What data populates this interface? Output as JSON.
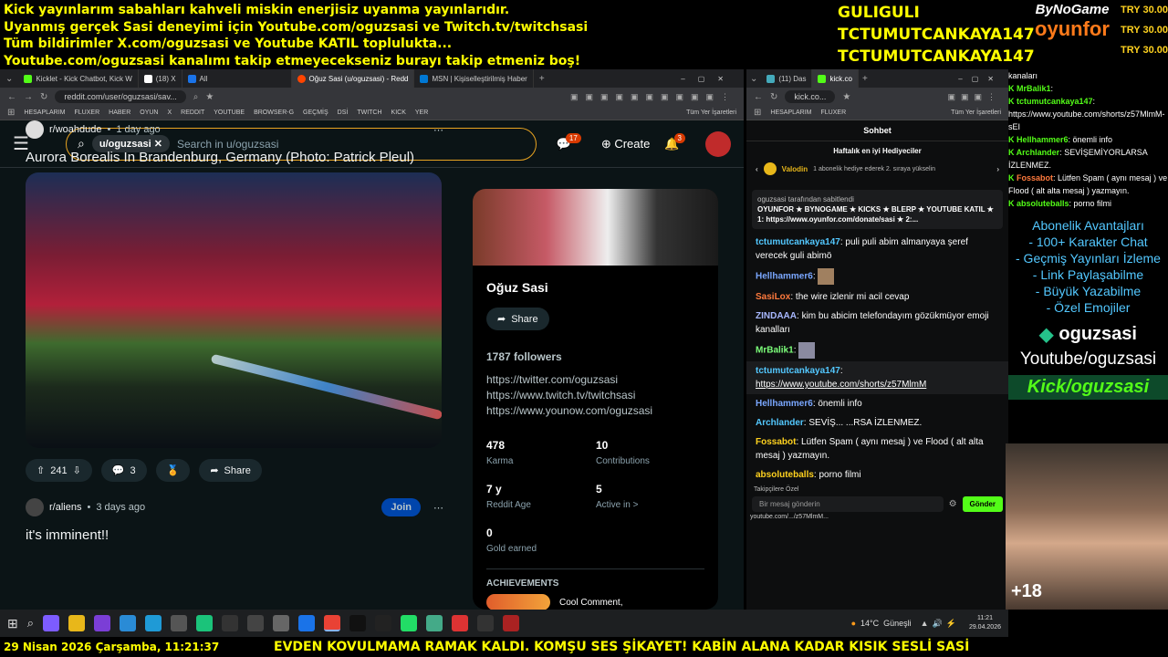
{
  "banner": {
    "lines": [
      "Kick yayınlarım sabahları kahveli miskin enerjisiz uyanma yayınlarıdır.",
      "Uyanmış gerçek Sasi deneyimi için Youtube.com/oguzsasi ve Twitch.tv/twitchsasi",
      "Tüm bildirimler X.com/oguzsasi ve Youtube KATIL toplulukta...",
      "Youtube.com/oguzsasi kanalımı takip etmeyecekseniz burayı takip etmeniz boş!"
    ]
  },
  "donors": [
    "GULIGULI",
    "TCTUMUTCANKAYA147",
    "TCTUMUTCANKAYA147"
  ],
  "bynogame": {
    "line1": "ByNoGame",
    "line2": "oyunfor"
  },
  "try": [
    "TRY 30.00",
    "TRY 30.00",
    "TRY 30.00"
  ],
  "browser1": {
    "tabs": [
      "Kicklet - Kick Chatbot, Kick W",
      "(18) X",
      "All",
      "Oğuz Sasi (u/oguzsasi) - Redd",
      "MSN | Kişiselleştirilmiş Haber"
    ],
    "url": "reddit.com/user/oguzsasi/sav...",
    "bookmarks": [
      "HESAPLARIM",
      "FLUXER",
      "HABER",
      "OYUN",
      "X",
      "REDDIT",
      "YOUTUBE",
      "BROWSER-G",
      "GEÇMİŞ",
      "DSİ",
      "TWITCH",
      "KICK",
      "YER",
      "Tüm Yer İşaretleri"
    ],
    "search_chip": "u/oguzsasi",
    "search_placeholder": "Search in u/oguzsasi",
    "chat_badge": "17",
    "notif_badge": "3",
    "create": "Create"
  },
  "feed": {
    "post1": {
      "sub": "r/woahdude",
      "time": "1 day ago",
      "title": "Aurora Borealis In Brandenburg, Germany (Photo: Patrick Pleul)",
      "votes": "241",
      "comments": "3",
      "share": "Share"
    },
    "post2": {
      "sub": "r/aliens",
      "time": "3 days ago",
      "title": "it's imminent!!",
      "join": "Join"
    }
  },
  "profile": {
    "name": "Oğuz Sasi",
    "share": "Share",
    "followers": "1787 followers",
    "links": [
      "https://twitter.com/oguzsasi",
      "https://www.twitch.tv/twitchsasi",
      "https://www.younow.com/oguzsasi"
    ],
    "stats": [
      {
        "v": "478",
        "l": "Karma"
      },
      {
        "v": "10",
        "l": "Contributions"
      },
      {
        "v": "7 y",
        "l": "Reddit Age"
      },
      {
        "v": "5",
        "l": "Active in >"
      },
      {
        "v": "0",
        "l": "Gold earned"
      }
    ],
    "achievements": "ACHIEVEMENTS",
    "achievement_name": "Cool Comment,"
  },
  "browser2": {
    "tabs": [
      "(11) Das",
      "kick.co"
    ],
    "url": "kick.co...",
    "bookmarks": [
      "HESAPLARIM",
      "FLUXER",
      "Tüm Yer İşaretleri"
    ],
    "chat_title": "Sohbet",
    "gifters_title": "Haftalık en iyi Hediyeciler",
    "gifter": "Valodin",
    "gifter_note": "1 abonelik hediye ederek 2. sıraya yükselin",
    "pinned_by": "oguzsasi tarafından sabitlendi",
    "pinned_text": "OYUNFOR ★ BYNOGAME ★ KICKS ★ BLERP ★ YOUTUBE KATIL ★ 1: https://www.oyunfor.com/donate/sasi ★ 2:...",
    "messages": [
      {
        "user": "tctumutcankaya147",
        "text": "puli puli abim almanyaya şeref verecek guli abimö"
      },
      {
        "user": "Hellhammer6",
        "text": ""
      },
      {
        "user": "SasiLox",
        "text": "the wire izlenir mi acil cevap"
      },
      {
        "user": "ZINDAAA",
        "text": "kim bu abicim telefondayım gözükmüyor emoji kanalları"
      },
      {
        "user": "MrBalik1",
        "text": ""
      },
      {
        "user": "tctumutcankaya147",
        "text": "https://www.youtube.com/shorts/z57MlmM"
      },
      {
        "user": "Hellhammer6",
        "text": "önemli info"
      },
      {
        "user": "Archlander",
        "text": "SEVİŞ... ...RSA İZLENMEZ."
      },
      {
        "user": "Fossabot",
        "text": "Lütfen Spam ( aynı mesaj ) ve Flood ( alt alta mesaj ) yazmayın."
      },
      {
        "user": "absoluteballs",
        "text": "porno filmi"
      }
    ],
    "followers_only": "Takipçilere Özel",
    "input_placeholder": "Bir mesaj gönderin",
    "send": "Gönder",
    "hover_url": "youtube.com/.../z57MlmM..."
  },
  "rightcol": {
    "messages": [
      {
        "user": "",
        "text": "kanaları"
      },
      {
        "user": "MrBalik1",
        "text": ":"
      },
      {
        "user": "tctumutcankaya147",
        "text": ": https://www.youtube.com/shorts/z57MlmM-sEI"
      },
      {
        "user": "Hellhammer6",
        "text": ": önemli info"
      },
      {
        "user": "Archlander",
        "text": ": SEVİŞEMİYORLARSA İZLENMEZ."
      },
      {
        "user": "Fossabot",
        "text": ": Lütfen Spam ( aynı mesaj ) ve Flood ( alt alta mesaj ) yazmayın."
      },
      {
        "user": "absoluteballs",
        "text": ": porno filmi"
      }
    ],
    "perks": [
      "Abonelik Avantajları",
      "- 100+ Karakter Chat",
      "- Geçmiş Yayınları İzleme",
      "- Link Paylaşabilme",
      "- Büyük Yazabilme",
      "- Özel Emojiler"
    ],
    "handle": "oguzsasi",
    "youtube": "Youtube/oguzsasi",
    "kick": "Kick/oguzsasi"
  },
  "cam": {
    "overlay": "+18"
  },
  "taskbar": {
    "weather": "14°C",
    "weather_text": "Güneşli",
    "time": "11:21",
    "date": "29.04.2026"
  },
  "ticker": {
    "date": "29 Nisan 2026 Çarşamba, 11:21:37",
    "text": "EVDEN KOVULMAMA RAMAK KALDI. KOMŞU SES ŞİKAYET! KABİN ALANA KADAR KISIK SESLİ SASİ"
  }
}
